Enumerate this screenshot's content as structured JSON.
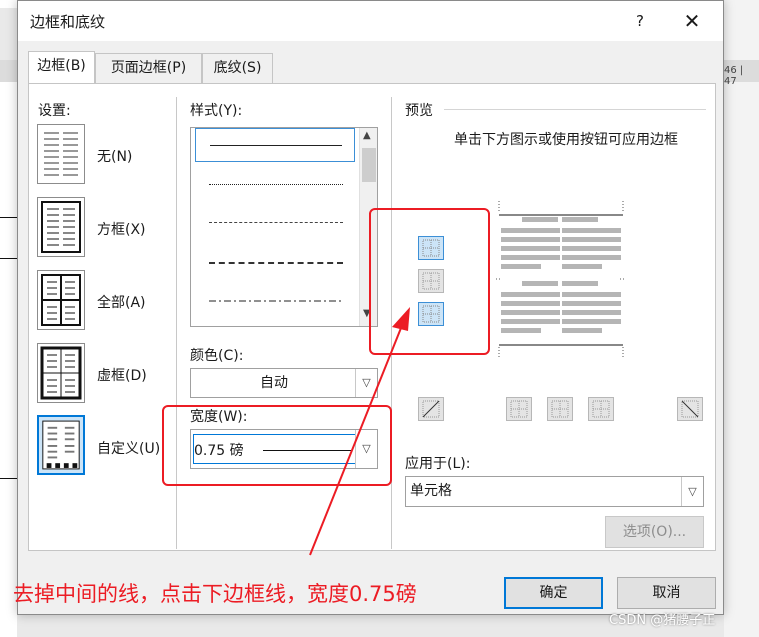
{
  "background_app": {
    "ruler_text": "46 | 47"
  },
  "dialog": {
    "title": "边框和底纹",
    "help": "?",
    "close": "✕"
  },
  "tabs": [
    {
      "label": "边框(B)",
      "active": true
    },
    {
      "label": "页面边框(P)",
      "active": false
    },
    {
      "label": "底纹(S)",
      "active": false
    }
  ],
  "settings": {
    "header": "设置:",
    "items": [
      {
        "label": "无(N)"
      },
      {
        "label": "方框(X)"
      },
      {
        "label": "全部(A)"
      },
      {
        "label": "虚框(D)"
      },
      {
        "label": "自定义(U)",
        "selected": true
      }
    ]
  },
  "style": {
    "header": "样式(Y):",
    "lines": [
      "solid",
      "dotted",
      "dashed-fine",
      "dashed",
      "dash-dot"
    ]
  },
  "color": {
    "label": "颜色(C):",
    "value": "自动"
  },
  "width": {
    "label": "宽度(W):",
    "value": "0.75 磅"
  },
  "preview": {
    "header": "预览",
    "hint": "单击下方图示或使用按钮可应用边框"
  },
  "apply_to": {
    "label": "应用于(L):",
    "value": "单元格"
  },
  "buttons": {
    "options": "选项(O)...",
    "ok": "确定",
    "cancel": "取消"
  },
  "annotation": "去掉中间的线，点击下边框线，宽度0.75磅",
  "watermark": "CSDN @猪腰子正",
  "colors": {
    "accent": "#0078d7",
    "annotation_red": "#ec1c24"
  }
}
